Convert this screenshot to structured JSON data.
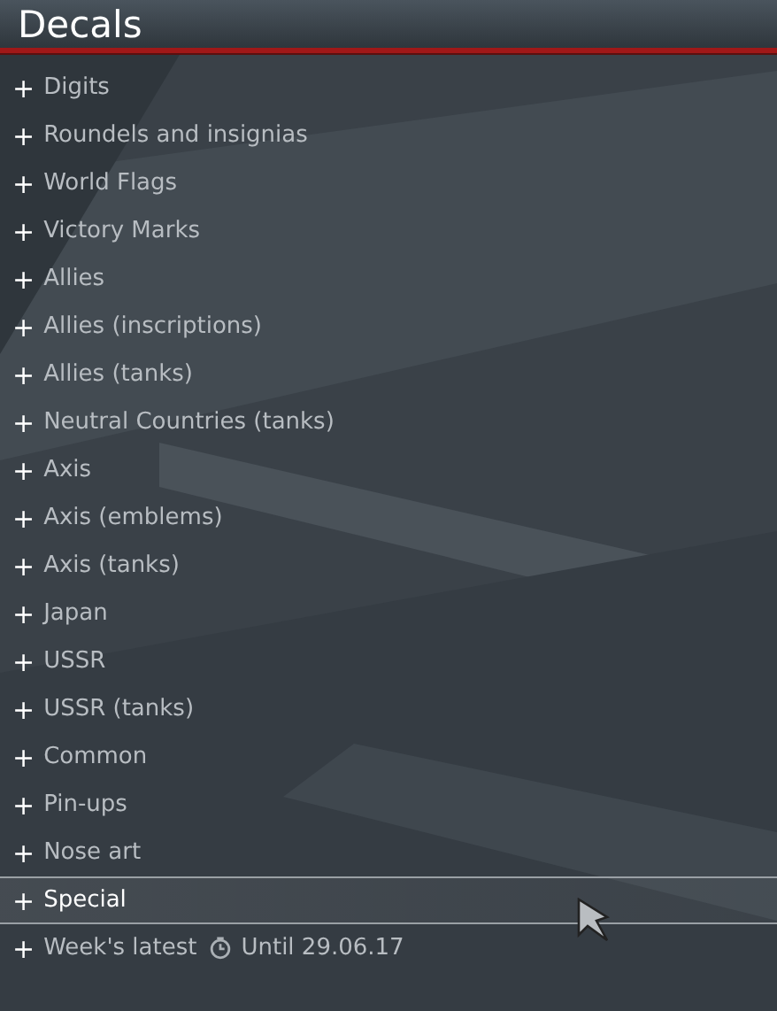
{
  "window": {
    "title": "Decals"
  },
  "categories": [
    {
      "toggle": "+",
      "label": "Digits",
      "selected": false
    },
    {
      "toggle": "+",
      "label": "Roundels and insignias",
      "selected": false
    },
    {
      "toggle": "+",
      "label": "World Flags",
      "selected": false
    },
    {
      "toggle": "+",
      "label": "Victory Marks",
      "selected": false
    },
    {
      "toggle": "+",
      "label": "Allies",
      "selected": false
    },
    {
      "toggle": "+",
      "label": "Allies (inscriptions)",
      "selected": false
    },
    {
      "toggle": "+",
      "label": "Allies (tanks)",
      "selected": false
    },
    {
      "toggle": "+",
      "label": "Neutral Countries (tanks)",
      "selected": false
    },
    {
      "toggle": "+",
      "label": "Axis",
      "selected": false
    },
    {
      "toggle": "+",
      "label": "Axis (emblems)",
      "selected": false
    },
    {
      "toggle": "+",
      "label": "Axis (tanks)",
      "selected": false
    },
    {
      "toggle": "+",
      "label": "Japan",
      "selected": false
    },
    {
      "toggle": "+",
      "label": "USSR",
      "selected": false
    },
    {
      "toggle": "+",
      "label": "USSR (tanks)",
      "selected": false
    },
    {
      "toggle": "+",
      "label": "Common",
      "selected": false
    },
    {
      "toggle": "+",
      "label": "Pin-ups",
      "selected": false
    },
    {
      "toggle": "+",
      "label": "Nose art",
      "selected": false
    },
    {
      "toggle": "+",
      "label": "Special",
      "selected": true
    },
    {
      "toggle": "+",
      "label": "Week's latest",
      "selected": false,
      "note": "Until 29.06.17"
    }
  ]
}
